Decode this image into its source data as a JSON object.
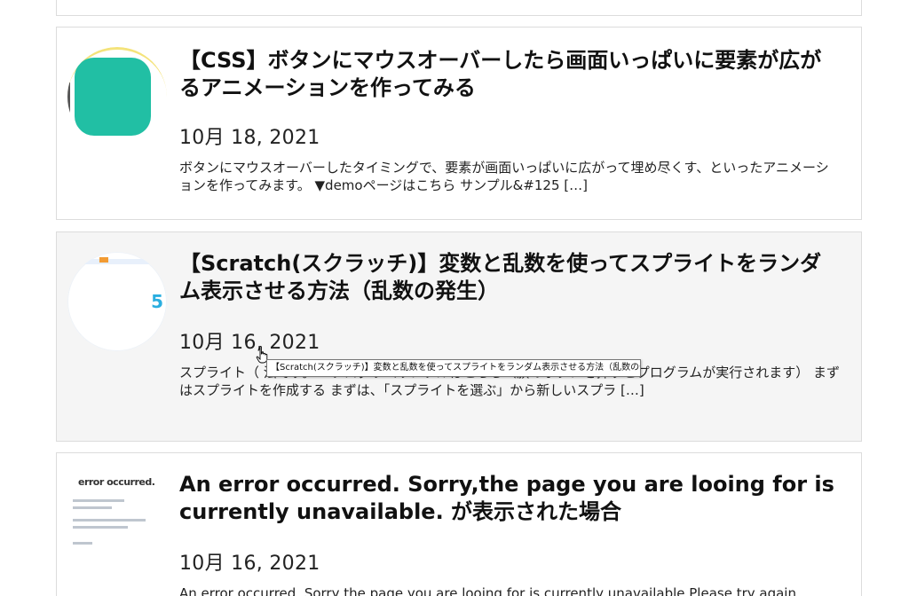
{
  "posts": [
    {
      "title": "【CSS】ボタンにマウスオーバーしたら画面いっぱいに要素が広がるアニメーションを作ってみる",
      "date": "10月 18, 2021",
      "excerpt": "ボタンにマウスオーバーしたタイミングで、要素が画面いっぱいに広がって埋め尽くす、といったアニメーションを作ってみます。 ▼demoページはこちら サンプル&#125 […]"
    },
    {
      "title": "【Scratch(スクラッチ)】変数と乱数を使ってスプライトをランダム表示させる方法（乱数の発生）",
      "date": "10月 16, 2021",
      "excerpt": "スプライト（                                                                                  法です。 ※プログラムサンプルはこちら（旗のボタンを押すとプログラムが実行されます） まずはスプライトを作成する まずは、「スプライトを選ぶ」から新しいスプラ […]",
      "thumb_badge": "5"
    },
    {
      "title": "An error occurred. Sorry,the page you are looing for is currently unavailable. が表示された場合",
      "date": "10月 16, 2021",
      "excerpt": "An error occurred. Sorry,the page you are looing for is currently unavailable.Please try again",
      "thumb_heading": "error occurred."
    }
  ],
  "tooltip": "【Scratch(スクラッチ)】変数と乱数を使ってスプライトをランダム表示させる方法（乱数の発生）",
  "icons": {
    "cursor": "hand-pointer-icon"
  },
  "colors": {
    "card_border": "#dcdcdc",
    "hover_background": "#f5f5f5",
    "teal": "#21bfa4"
  }
}
